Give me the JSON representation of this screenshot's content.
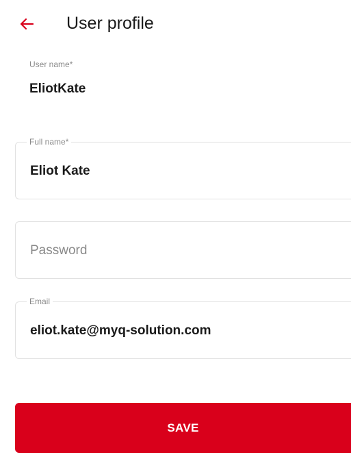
{
  "header": {
    "title": "User profile",
    "back_icon": "arrow-left-icon",
    "accent_color": "#d9001b"
  },
  "form": {
    "username": {
      "label": "User name*",
      "value": "EliotKate"
    },
    "fullname": {
      "label": "Full name*",
      "value": "Eliot Kate"
    },
    "password": {
      "placeholder": "Password"
    },
    "email": {
      "label": "Email",
      "value": "eliot.kate@myq-solution.com"
    }
  },
  "actions": {
    "save_label": "SAVE",
    "save_color": "#d9001b"
  }
}
